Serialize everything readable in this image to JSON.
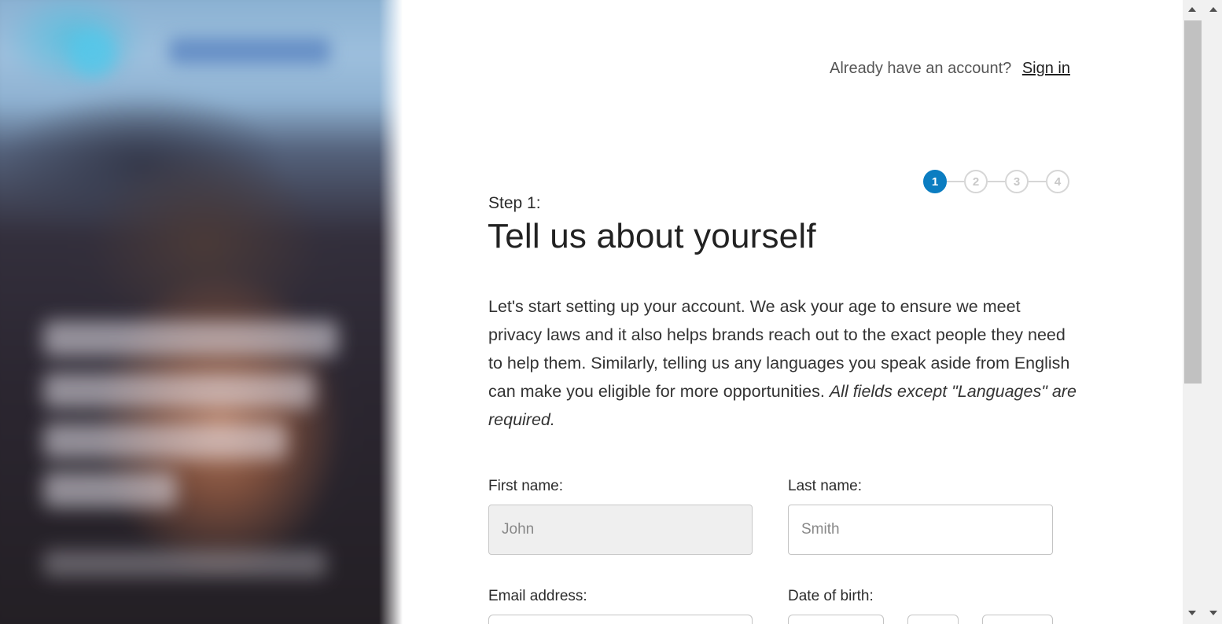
{
  "header": {
    "signin_prompt": "Already have an account?",
    "signin_link": "Sign in"
  },
  "stepper": {
    "steps": [
      "1",
      "2",
      "3",
      "4"
    ],
    "current": 1,
    "active_color": "#0b7dc1"
  },
  "step_label": "Step 1:",
  "title": "Tell us about yourself",
  "intro": {
    "text": "Let's start setting up your account. We ask your age to ensure we meet privacy laws and it also helps brands reach out to the exact people they need to help them. Similarly, telling us any languages you speak aside from English can make you eligible for more opportunities.",
    "emphasis": "All fields except \"Languages\" are required."
  },
  "form": {
    "first_name": {
      "label": "First name:",
      "placeholder": "John"
    },
    "last_name": {
      "label": "Last name:",
      "placeholder": "Smith"
    },
    "email": {
      "label": "Email address:"
    },
    "date_of_birth": {
      "label": "Date of birth:"
    }
  }
}
